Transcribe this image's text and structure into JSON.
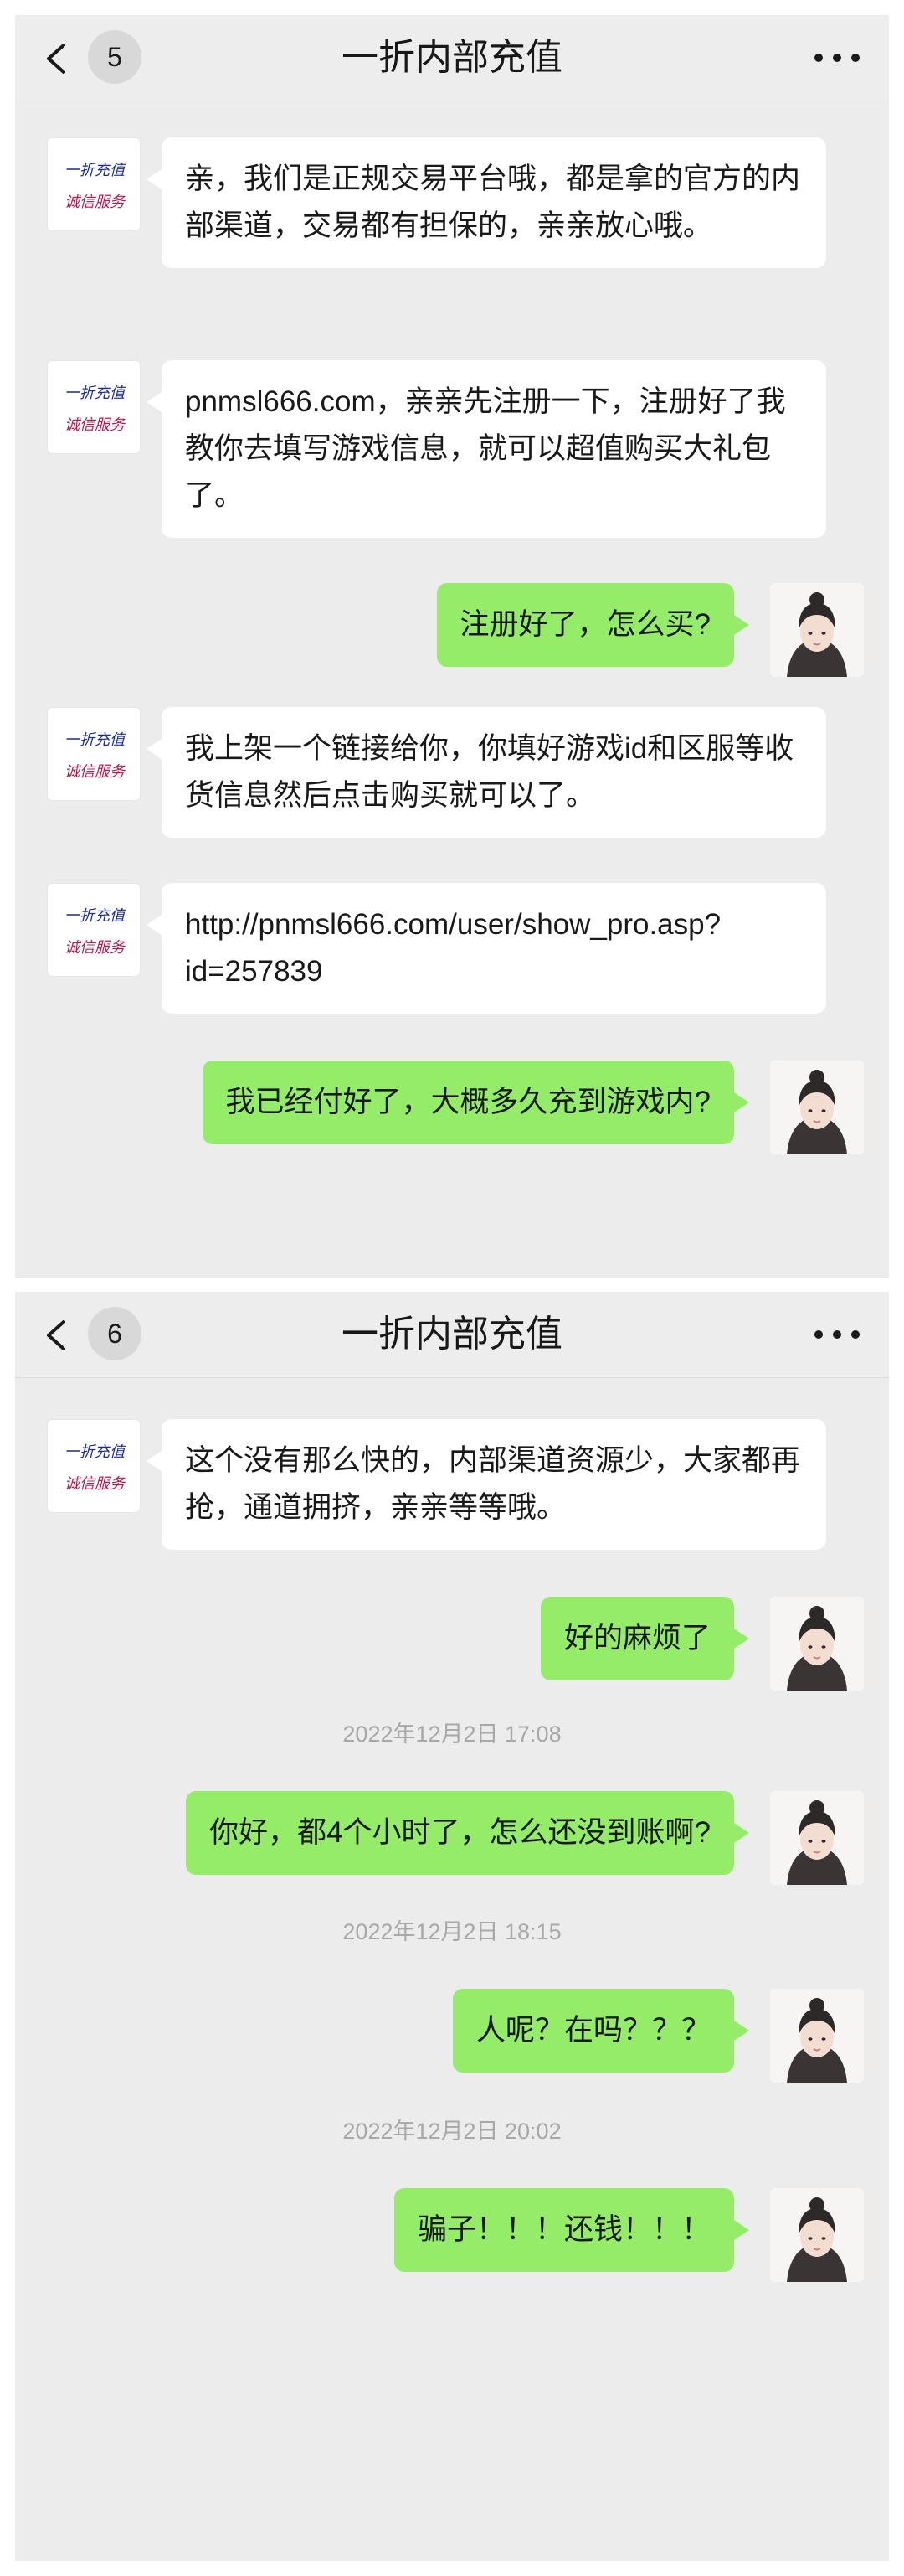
{
  "screen1": {
    "header": {
      "back_count": "5",
      "title": "一折内部充值"
    },
    "messages": [
      {
        "side": "left",
        "text": "亲，我们是正规交易平台哦，都是拿的官方的内部渠道，交易都有担保的，亲亲放心哦。"
      },
      {
        "side": "left",
        "text": "pnmsl666.com，亲亲先注册一下，注册好了我教你去填写游戏信息，就可以超值购买大礼包了。"
      },
      {
        "side": "right",
        "text": "注册好了，怎么买?"
      },
      {
        "side": "left",
        "text": "我上架一个链接给你，你填好游戏id和区服等收货信息然后点击购买就可以了。"
      },
      {
        "side": "left",
        "text": "http://pnmsl666.com/user/show_pro.asp?id=257839"
      },
      {
        "side": "right",
        "text": "我已经付好了，大概多久充到游戏内?"
      }
    ]
  },
  "screen2": {
    "header": {
      "back_count": "6",
      "title": "一折内部充值"
    },
    "messages": [
      {
        "side": "left",
        "text": "这个没有那么快的，内部渠道资源少，大家都再抢，通道拥挤，亲亲等等哦。"
      },
      {
        "side": "right",
        "text": "好的麻烦了"
      },
      {
        "timestamp": "2022年12月2日 17:08"
      },
      {
        "side": "right",
        "text": "你好，都4个小时了，怎么还没到账啊?"
      },
      {
        "timestamp": "2022年12月2日 18:15"
      },
      {
        "side": "right",
        "text": "人呢？在吗？？？"
      },
      {
        "timestamp": "2022年12月2日 20:02"
      },
      {
        "side": "right",
        "text": "骗子！！！还钱！！！"
      }
    ]
  },
  "shop_avatar": {
    "line1": "一折充值",
    "line2": "诚信服务",
    "line1_color": "#1a2a9e",
    "line2_color": "#c0144a"
  },
  "colors": {
    "sent_bubble": "#95ec69",
    "received_bubble": "#ffffff",
    "background": "#ececec"
  }
}
